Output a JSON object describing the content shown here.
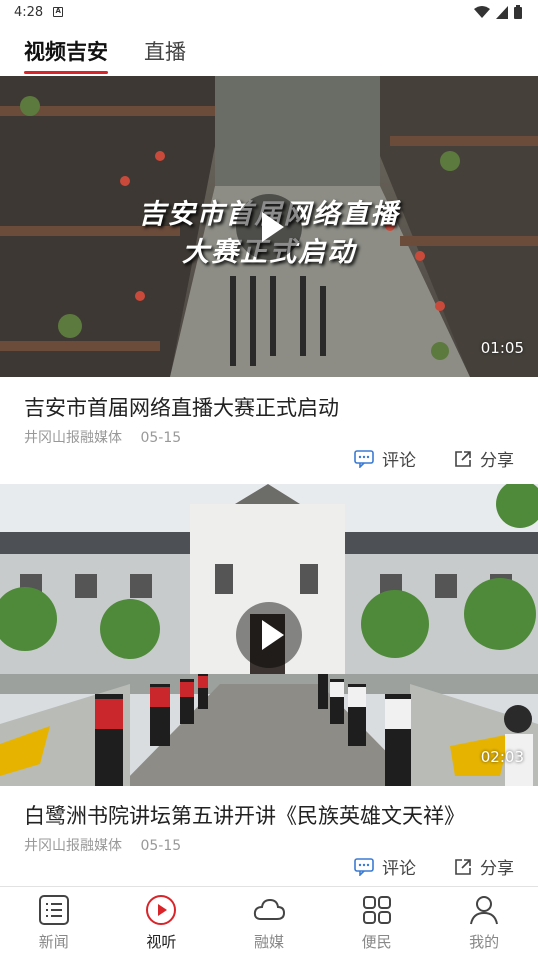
{
  "status_bar": {
    "time": "4:28",
    "sim_label": "A"
  },
  "tabs": [
    {
      "label": "视频吉安",
      "active": true
    },
    {
      "label": "直播",
      "active": false
    }
  ],
  "feed": [
    {
      "overlay_line1": "吉安市首届网络直播",
      "overlay_line2": "大赛正式启动",
      "duration": "01:05",
      "title": "吉安市首届网络直播大赛正式启动",
      "source": "井冈山报融媒体",
      "date": "05-15",
      "comment_label": "评论",
      "share_label": "分享"
    },
    {
      "duration": "02:03",
      "title": "白鹭洲书院讲坛第五讲开讲《民族英雄文天祥》",
      "source": "井冈山报融媒体",
      "date": "05-15",
      "comment_label": "评论",
      "share_label": "分享"
    }
  ],
  "bottom_nav": [
    {
      "label": "新闻",
      "icon": "news-list-icon",
      "active": false
    },
    {
      "label": "视听",
      "icon": "play-circle-icon",
      "active": true
    },
    {
      "label": "融媒",
      "icon": "cloud-icon",
      "active": false
    },
    {
      "label": "便民",
      "icon": "grid-icon",
      "active": false
    },
    {
      "label": "我的",
      "icon": "person-icon",
      "active": false
    }
  ],
  "colors": {
    "accent": "#d9252a",
    "text": "#222222",
    "muted": "#999999"
  }
}
